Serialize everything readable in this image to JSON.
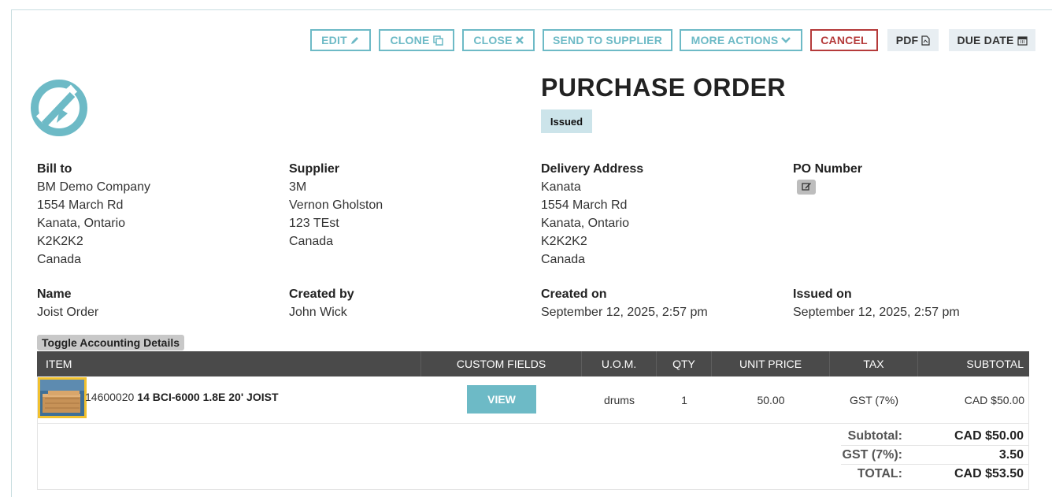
{
  "toolbar": {
    "edit": "EDIT",
    "clone": "CLONE",
    "close": "CLOSE",
    "send": "SEND TO SUPPLIER",
    "more": "MORE ACTIONS",
    "cancel": "CANCEL",
    "pdf": "PDF",
    "due_date": "DUE DATE"
  },
  "colors": {
    "accent": "#6dbac6",
    "cancel": "#b53a3a",
    "header_bg": "#4a4a4a",
    "highlight": "#f2c12e"
  },
  "title": "PURCHASE ORDER",
  "status": "Issued",
  "bill_to": {
    "label": "Bill to",
    "lines": [
      "BM Demo Company",
      "1554 March Rd",
      "Kanata, Ontario",
      "K2K2K2",
      "Canada"
    ]
  },
  "supplier": {
    "label": "Supplier",
    "lines": [
      "3M",
      "Vernon Gholston",
      "123 TEst",
      "Canada"
    ]
  },
  "delivery": {
    "label": "Delivery Address",
    "lines": [
      "Kanata",
      "1554 March Rd",
      "Kanata, Ontario",
      "K2K2K2",
      "Canada"
    ]
  },
  "po_number": {
    "label": "PO Number"
  },
  "name": {
    "label": "Name",
    "value": "Joist Order"
  },
  "created_by": {
    "label": "Created by",
    "value": "John Wick"
  },
  "created_on": {
    "label": "Created on",
    "value": "September 12, 2025, 2:57 pm"
  },
  "issued_on": {
    "label": "Issued on",
    "value": "September 12, 2025, 2:57 pm"
  },
  "toggle_accounting": "Toggle Accounting Details",
  "table": {
    "headers": [
      "ITEM",
      "CUSTOM FIELDS",
      "U.O.M.",
      "QTY",
      "UNIT PRICE",
      "TAX",
      "SUBTOTAL"
    ],
    "row": {
      "sku": "14600020",
      "name": "14 BCI-6000 1.8E 20' JOIST",
      "custom_fields_button": "VIEW",
      "uom": "drums",
      "qty": "1",
      "unit_price": "50.00",
      "tax": "GST (7%)",
      "subtotal": "CAD $50.00"
    }
  },
  "totals": {
    "subtotal_label": "Subtotal:",
    "subtotal_value": "CAD $50.00",
    "gst_label": "GST (7%):",
    "gst_value": "3.50",
    "total_label": "TOTAL:",
    "total_value": "CAD $53.50"
  }
}
